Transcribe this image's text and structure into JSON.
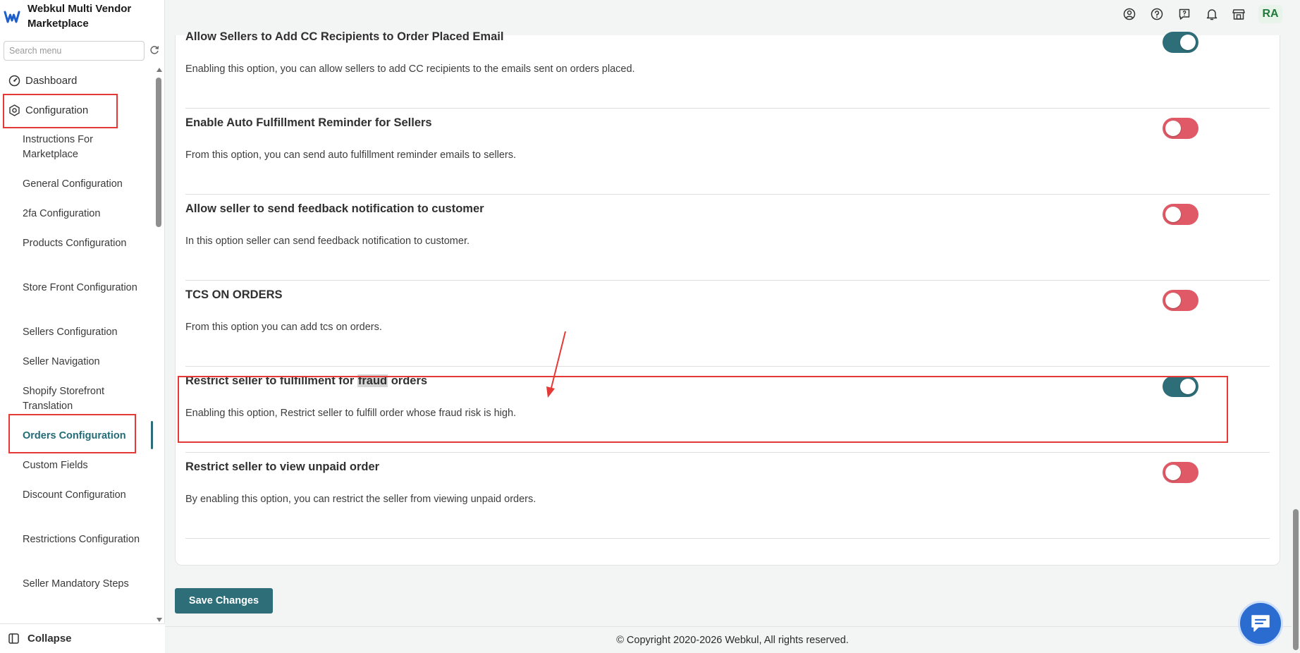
{
  "brand": {
    "name": "Webkul Multi Vendor Marketplace"
  },
  "search": {
    "placeholder": "Search menu"
  },
  "sidebar": {
    "top_items": [
      {
        "label": "Dashboard"
      },
      {
        "label": "Configuration"
      }
    ],
    "sub_items": [
      {
        "label": "Instructions For Marketplace"
      },
      {
        "label": "General Configuration"
      },
      {
        "label": "2fa Configuration"
      },
      {
        "label": "Products Configuration"
      },
      {
        "label": "Store Front Configuration"
      },
      {
        "label": "Sellers Configuration"
      },
      {
        "label": "Seller Navigation"
      },
      {
        "label": "Shopify Storefront Translation"
      },
      {
        "label": "Orders Configuration"
      },
      {
        "label": "Custom Fields"
      },
      {
        "label": "Discount Configuration"
      },
      {
        "label": "Restrictions Configuration"
      },
      {
        "label": "Seller Mandatory Steps"
      }
    ],
    "collapse_label": "Collapse"
  },
  "header": {
    "avatar_initials": "RA"
  },
  "settings": [
    {
      "title": "Allow Sellers to Add CC Recipients to Order Placed Email",
      "description": "Enabling this option, you can allow sellers to add CC recipients to the emails sent on orders placed.",
      "enabled": true
    },
    {
      "title": "Enable Auto Fulfillment Reminder for Sellers",
      "description": "From this option, you can send auto fulfillment reminder emails to sellers.",
      "enabled": false
    },
    {
      "title": "Allow seller to send feedback notification to customer",
      "description": "In this option seller can send feedback notification to customer.",
      "enabled": false
    },
    {
      "title": "TCS ON ORDERS",
      "description": "From this option you can add tcs on orders.",
      "enabled": false
    },
    {
      "title_prefix": "Restrict seller to fulfillment for ",
      "title_highlight": "fraud",
      "title_suffix": " orders",
      "description": "Enabling this option, Restrict seller to fulfill order whose fraud risk is high.",
      "enabled": true
    },
    {
      "title": "Restrict seller to view unpaid order",
      "description": "By enabling this option, you can restrict the seller from viewing unpaid orders.",
      "enabled": false
    }
  ],
  "save_label": "Save Changes",
  "footer": {
    "copyright": "© Copyright 2020-2026 Webkul, All rights reserved."
  },
  "colors": {
    "accent": "#2e6e79",
    "toggle_off": "#df5a66",
    "annotation": "#e53935",
    "chat": "#2b6cd0"
  }
}
